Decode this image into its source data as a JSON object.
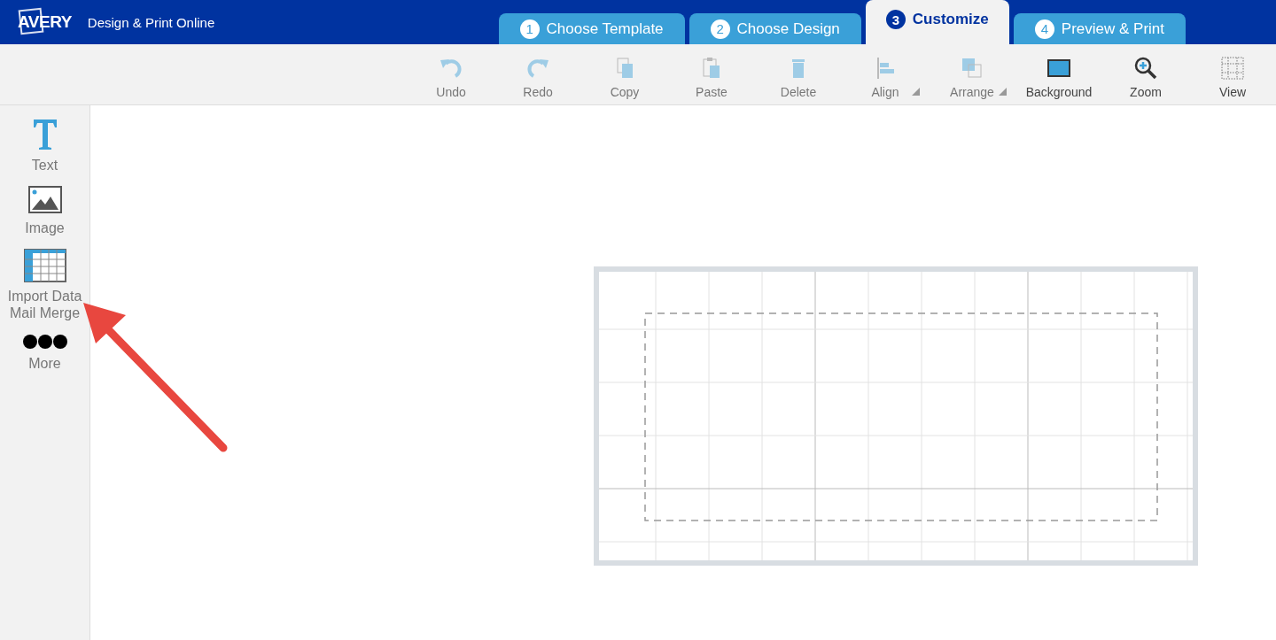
{
  "header": {
    "brand": "AVERY",
    "title": "Design & Print Online"
  },
  "steps": [
    {
      "number": "1",
      "label": "Choose Template",
      "selected": false
    },
    {
      "number": "2",
      "label": "Choose Design",
      "selected": false
    },
    {
      "number": "3",
      "label": "Customize",
      "selected": true
    },
    {
      "number": "4",
      "label": "Preview & Print",
      "selected": false
    }
  ],
  "toolbar": [
    {
      "kind": "undo",
      "label": "Undo",
      "disabled": true,
      "has_menu": false
    },
    {
      "kind": "redo",
      "label": "Redo",
      "disabled": true,
      "has_menu": false
    },
    {
      "kind": "copy",
      "label": "Copy",
      "disabled": true,
      "has_menu": false
    },
    {
      "kind": "paste",
      "label": "Paste",
      "disabled": true,
      "has_menu": false
    },
    {
      "kind": "delete",
      "label": "Delete",
      "disabled": true,
      "has_menu": false
    },
    {
      "kind": "align",
      "label": "Align",
      "disabled": true,
      "has_menu": true
    },
    {
      "kind": "arrange",
      "label": "Arrange",
      "disabled": true,
      "has_menu": true
    },
    {
      "kind": "background",
      "label": "Background",
      "disabled": false,
      "has_menu": false
    },
    {
      "kind": "zoom",
      "label": "Zoom",
      "disabled": false,
      "has_menu": false
    },
    {
      "kind": "view",
      "label": "View",
      "disabled": false,
      "has_menu": false
    }
  ],
  "sidebar": [
    {
      "kind": "text",
      "label": "Text"
    },
    {
      "kind": "image",
      "label": "Image"
    },
    {
      "kind": "data",
      "label": "Import Data\nMail Merge"
    },
    {
      "kind": "more",
      "label": "More"
    }
  ]
}
